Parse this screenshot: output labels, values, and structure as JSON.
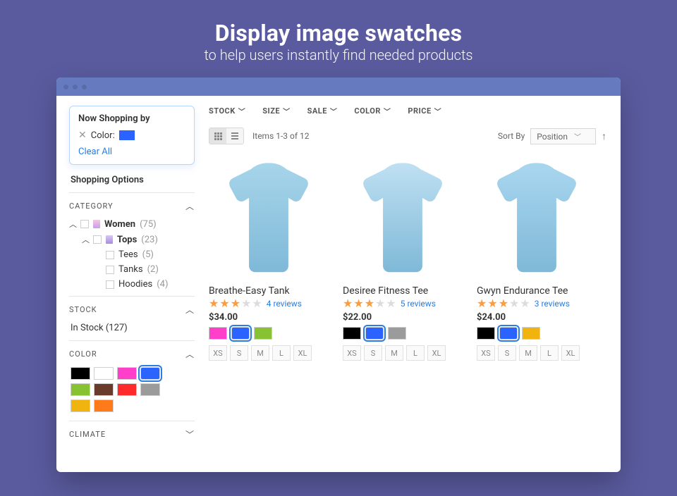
{
  "banner": {
    "title": "Display image swatches",
    "subtitle": "to help users instantly find needed products"
  },
  "sidebar": {
    "now_shopping": {
      "title": "Now Shopping by",
      "attribute": "Color:",
      "swatch_color": "#2a63ff",
      "clear_label": "Clear All"
    },
    "shopping_options_label": "Shopping Options",
    "category": {
      "head": "CATEGORY",
      "items": [
        {
          "label": "Women",
          "count": "(75)"
        },
        {
          "label": "Tops",
          "count": "(23)"
        },
        {
          "label": "Tees",
          "count": "(5)"
        },
        {
          "label": "Tanks",
          "count": "(2)"
        },
        {
          "label": "Hoodies",
          "count": "(4)"
        }
      ]
    },
    "stock": {
      "head": "STOCK",
      "line": "In Stock (127)"
    },
    "color": {
      "head": "COLOR",
      "swatches": [
        "#000000",
        "#ffffff",
        "#ff3ec9",
        "#2a63ff",
        "#86c232",
        "#6b3b2a",
        "#ff2a2a",
        "#9b9b9b",
        "#f1b40f",
        "#ff7a18"
      ],
      "selected_index": 3
    },
    "climate": {
      "head": "CLIMATE"
    }
  },
  "main": {
    "filters": [
      "STOCK",
      "SIZE",
      "SALE",
      "COLOR",
      "PRICE"
    ],
    "items_label": "Items 1-3 of 12",
    "sort_by_label": "Sort By",
    "sort_value": "Position",
    "sizes": [
      "XS",
      "S",
      "M",
      "L",
      "XL"
    ],
    "products": [
      {
        "name": "Breathe-Easy Tank",
        "stars": 3,
        "reviews": "4 reviews",
        "price": "$34.00",
        "swatches": [
          "#ff3ec9",
          "#2a63ff",
          "#86c232"
        ],
        "selected": 1,
        "tint": "#a7d5ea"
      },
      {
        "name": "Desiree Fitness Tee",
        "stars": 3,
        "reviews": "5 reviews",
        "price": "$22.00",
        "swatches": [
          "#000000",
          "#2a63ff",
          "#9b9b9b"
        ],
        "selected": 1,
        "tint": "#bfe0f2"
      },
      {
        "name": "Gwyn Endurance Tee",
        "stars": 3,
        "reviews": "3 reviews",
        "price": "$24.00",
        "swatches": [
          "#000000",
          "#2a63ff",
          "#f1b40f"
        ],
        "selected": 1,
        "tint": "#a9d6ef"
      }
    ]
  }
}
